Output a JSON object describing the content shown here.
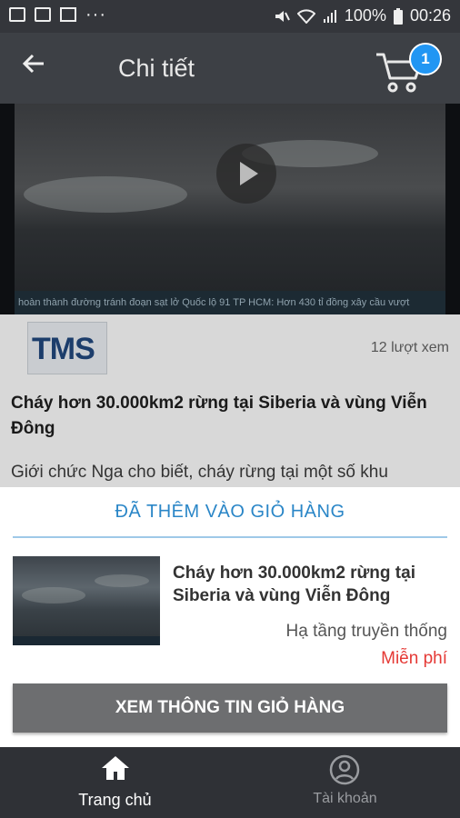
{
  "status_bar": {
    "battery": "100%",
    "time": "00:26",
    "dots": "···"
  },
  "app_bar": {
    "title": "Chi tiết",
    "cart_count": "1"
  },
  "video": {
    "ticker_text": "hoàn thành đường tránh đoạn sạt lở Quốc lộ 91   TP HCM: Hơn 430 tỉ đồng xây cầu vượt"
  },
  "article": {
    "channel_logo_text": "TMS",
    "views": "12 lượt xem",
    "title": "Cháy hơn 30.000km2 rừng tại Siberia và vùng Viễn Đông",
    "body": "Giới chức Nga cho biết, cháy rừng tại một số khu"
  },
  "sheet": {
    "heading": "ĐÃ THÊM VÀO GIỎ HÀNG",
    "item_title": "Cháy hơn 30.000km2 rừng tại Siberia và vùng Viễn Đông",
    "item_category": "Hạ tầng truyền thống",
    "item_price": "Miễn phí",
    "cta_label": "XEM THÔNG TIN GIỎ HÀNG"
  },
  "tabs": [
    {
      "label": "Trang chủ",
      "icon": "home-icon",
      "active": true
    },
    {
      "label": "Tài khoản",
      "icon": "account-icon",
      "active": false
    }
  ],
  "colors": {
    "accent": "#2196f3",
    "heading": "#2a86c7",
    "price": "#e53935"
  }
}
